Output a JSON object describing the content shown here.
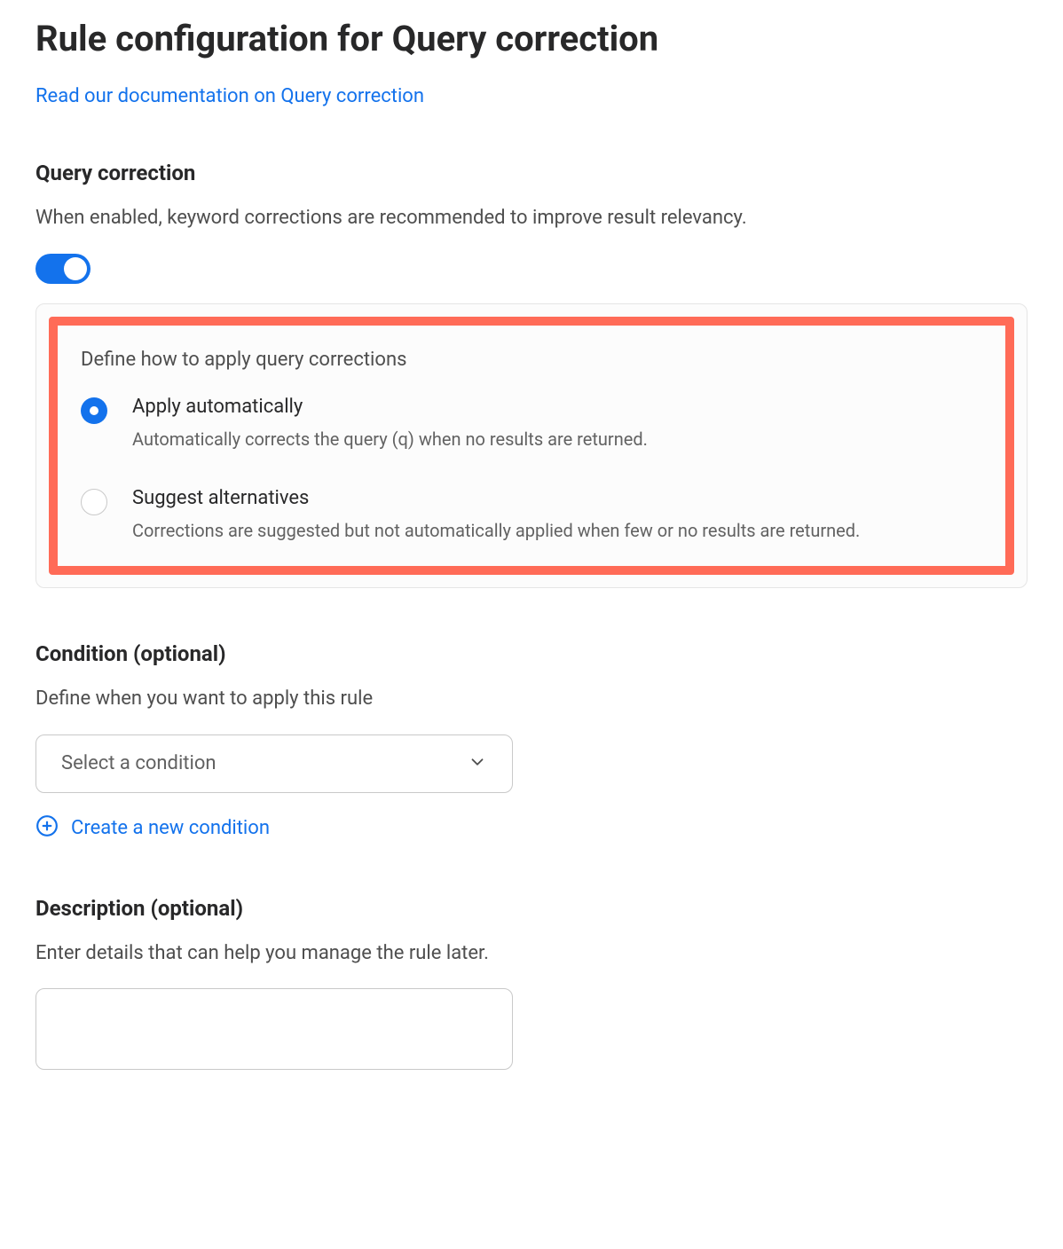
{
  "page": {
    "title": "Rule configuration for Query correction",
    "docLinkText": "Read our documentation on Query correction"
  },
  "queryCorrection": {
    "heading": "Query correction",
    "description": "When enabled, keyword corrections are recommended to improve result relevancy.",
    "enabled": true,
    "defineLabel": "Define how to apply query corrections",
    "options": [
      {
        "title": "Apply automatically",
        "description": "Automatically corrects the query (q) when no results are returned.",
        "selected": true
      },
      {
        "title": "Suggest alternatives",
        "description": "Corrections are suggested but not automatically applied when few or no results are returned.",
        "selected": false
      }
    ]
  },
  "condition": {
    "heading": "Condition (optional)",
    "description": "Define when you want to apply this rule",
    "selectPlaceholder": "Select a condition",
    "createLinkText": "Create a new condition"
  },
  "descriptionSection": {
    "heading": "Description (optional)",
    "description": "Enter details that can help you manage the rule later.",
    "value": ""
  }
}
